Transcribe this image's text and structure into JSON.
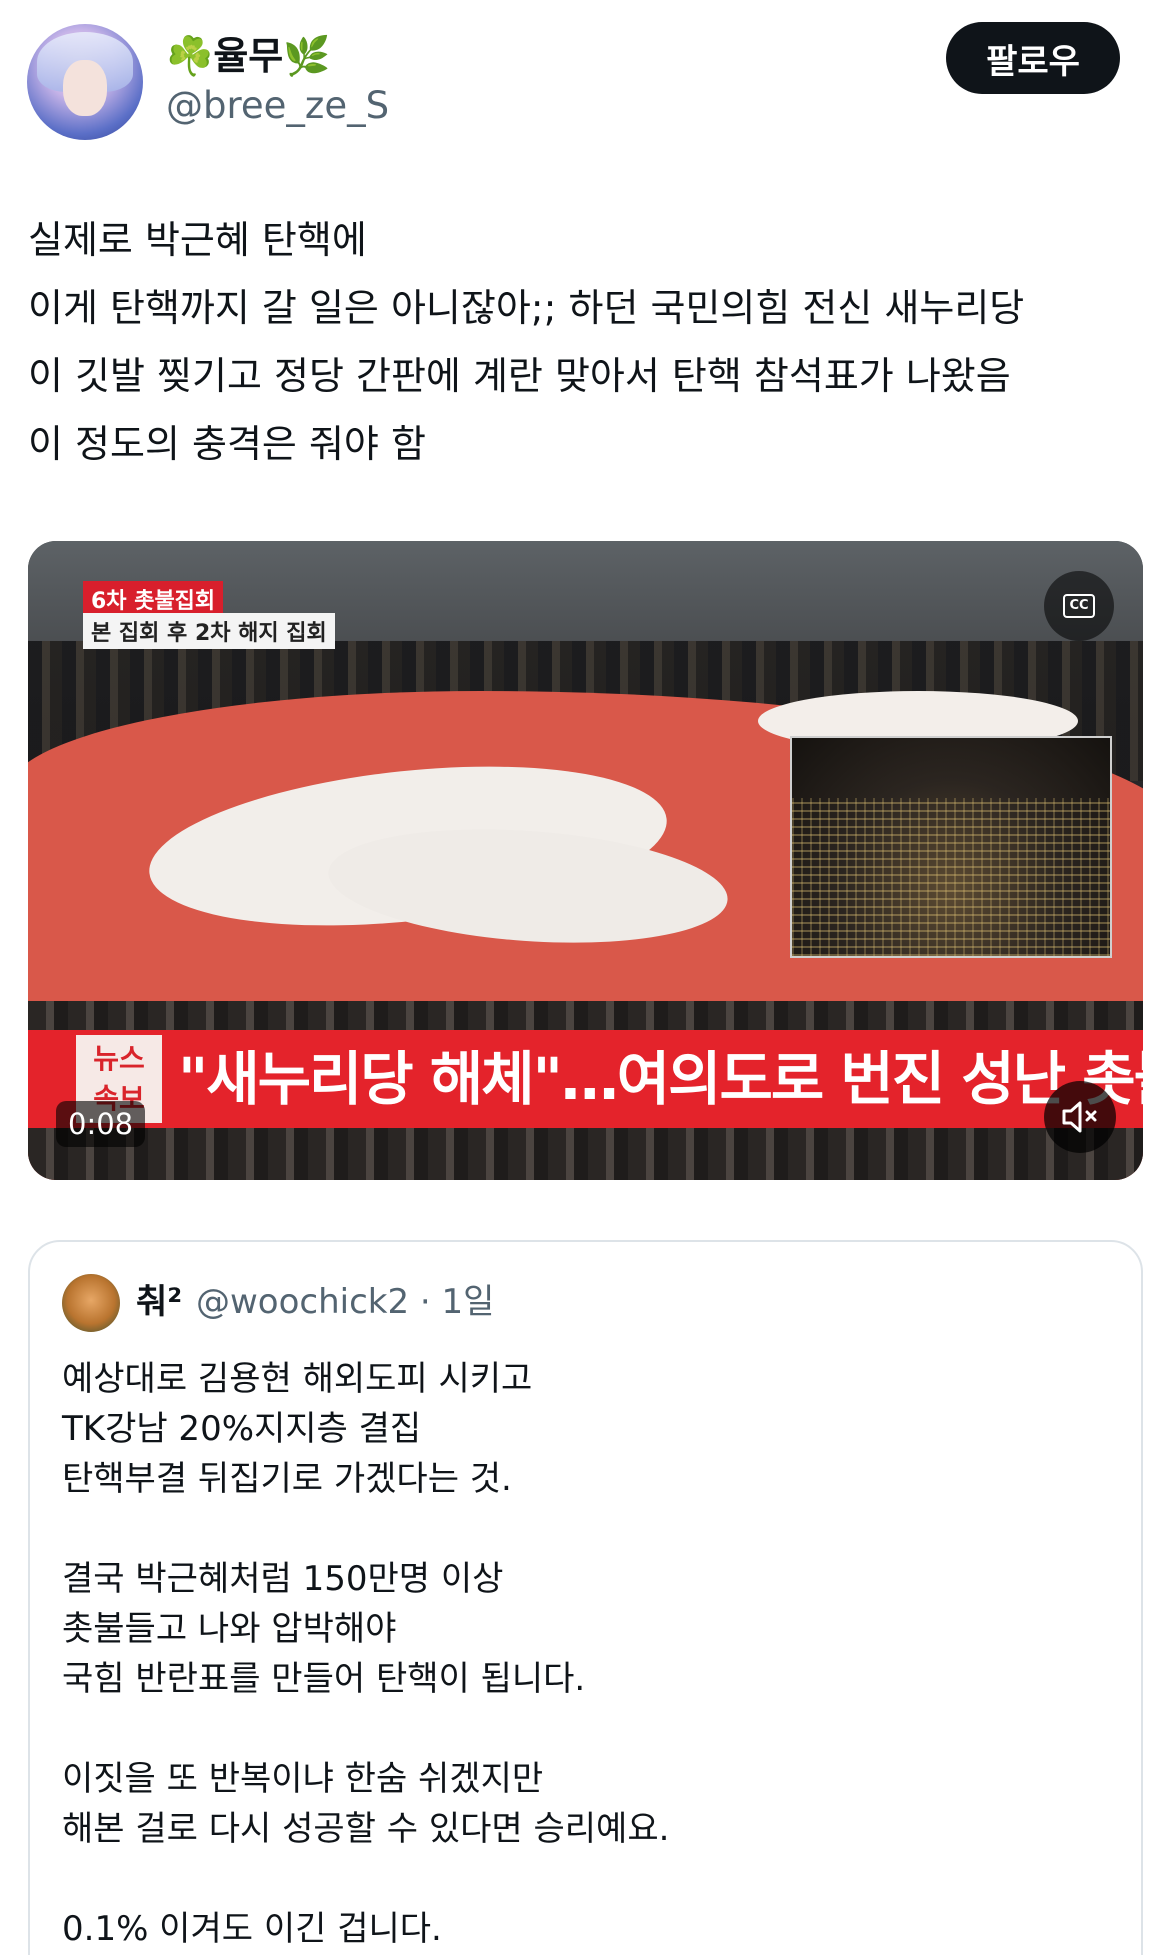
{
  "author": {
    "display_name": "☘️율무🌿",
    "handle": "@bree_ze_S"
  },
  "follow_label": "팔로우",
  "tweet_lines": [
    "실제로 박근혜 탄핵에",
    "이게 탄핵까지 갈 일은 아니잖아;; 하던 국민의힘 전신 새누리당",
    "이 깃발 찢기고 정당 간판에 계란 맞아서 탄핵 참석표가 나왔음",
    "이 정도의 충격은 줘야 함"
  ],
  "video": {
    "overlay_top": "6차 촛불집회",
    "overlay_sub": "본 집회 후 2차 해지 집회",
    "banner_tag_line1": "뉴스",
    "banner_tag_line2": "속보",
    "banner_text": "\"새누리당 해체\"…여의도로 번진 성난 촛불",
    "timestamp": "0:08",
    "cc_label": "CC",
    "cc_icon": "closed-captions-icon",
    "mute_icon": "muted-speaker-icon"
  },
  "quote": {
    "display_name": "춰²",
    "handle_time": "@woochick2 · 1일",
    "lines": [
      "예상대로 김용현 해외도피 시키고",
      "TK강남 20%지지층 결집",
      "탄핵부결 뒤집기로 가겠다는 것.",
      "",
      "결국 박근혜처럼 150만명 이상",
      "촛불들고 나와 압박해야",
      "국힘 반란표를 만들어 탄핵이 됩니다.",
      "",
      "이짓을 또 반복이냐 한숨 쉬겠지만",
      "해본 걸로 다시 성공할 수 있다면 승리예요.",
      "",
      "0.1% 이겨도 이긴 겁니다."
    ]
  }
}
